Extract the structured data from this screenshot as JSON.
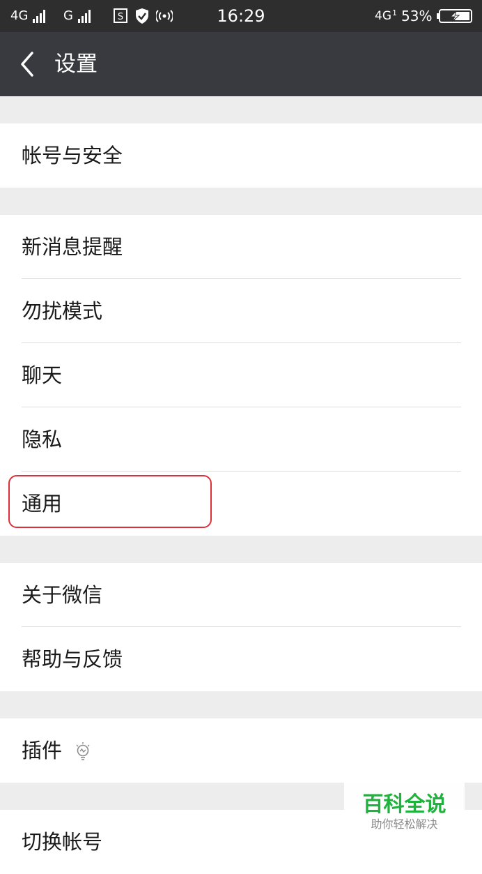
{
  "status_bar": {
    "sim1_network": "4G",
    "sim2_network": "G",
    "time": "16:29",
    "network_right": "4G",
    "network_right_sub": "1",
    "battery": "53%",
    "icons": [
      "signal-icon",
      "sim-app-icon",
      "shield-icon",
      "hotspot-icon",
      "battery-charging-icon"
    ]
  },
  "header": {
    "title": "设置",
    "back_icon": "chevron-left-icon"
  },
  "groups": {
    "account": {
      "items": [
        "帐号与安全"
      ]
    },
    "main": {
      "items": [
        "新消息提醒",
        "勿扰模式",
        "聊天",
        "隐私",
        "通用"
      ],
      "highlighted": "通用"
    },
    "about": {
      "items": [
        "关于微信",
        "帮助与反馈"
      ]
    },
    "plugins": {
      "label": "插件",
      "icon": "lightbulb-icon"
    },
    "switch": {
      "items": [
        "切换帐号"
      ]
    }
  },
  "colors": {
    "status_bar_bg": "#2e2e2e",
    "header_bg": "#393a3f",
    "page_bg": "#ededed",
    "highlight_border": "#d9303a",
    "watermark_green": "#1fb33e"
  },
  "watermark": {
    "main": "百科全说",
    "sub": "助你轻松解决"
  }
}
